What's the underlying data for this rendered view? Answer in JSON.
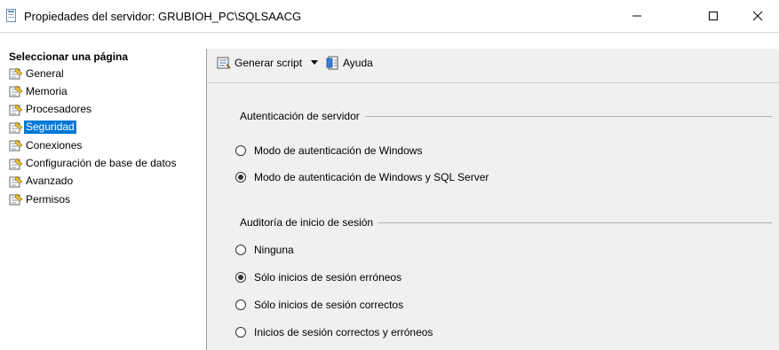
{
  "window": {
    "title": "Propiedades del servidor: GRUBIOH_PC\\SQLSAACG",
    "minimize_glyph": "—",
    "maximize_glyph": "☐",
    "close_glyph": "✕"
  },
  "left_pane": {
    "header": "Seleccionar una página",
    "pages": [
      {
        "label": "General",
        "icon": "page-icon"
      },
      {
        "label": "Memoria",
        "icon": "page-icon"
      },
      {
        "label": "Procesadores",
        "icon": "page-icon"
      },
      {
        "label": "Seguridad",
        "icon": "page-icon",
        "selected": true
      },
      {
        "label": "Conexiones",
        "icon": "page-icon"
      },
      {
        "label": "Configuración de base de datos",
        "icon": "page-icon"
      },
      {
        "label": "Avanzado",
        "icon": "page-icon"
      },
      {
        "label": "Permisos",
        "icon": "page-icon"
      }
    ]
  },
  "toolbar": {
    "script_label": "Generar script",
    "script_icon": "script-icon",
    "dropdown_icon": "dropdown-arrow-icon",
    "help_label": "Ayuda",
    "help_icon": "help-icon"
  },
  "server_auth": {
    "title": "Autenticación de servidor",
    "options": [
      {
        "label": "Modo de autenticación de Windows",
        "checked": false
      },
      {
        "label": "Modo de autenticación de Windows y SQL Server",
        "checked": true
      }
    ]
  },
  "login_audit": {
    "title": "Auditoría de inicio de sesión",
    "options": [
      {
        "label": "Ninguna",
        "checked": false
      },
      {
        "label": "Sólo inicios de sesión erróneos",
        "checked": true
      },
      {
        "label": "Sólo inicios de sesión correctos",
        "checked": false
      },
      {
        "label": "Inicios de sesión correctos y erróneos",
        "checked": false
      }
    ]
  },
  "colors": {
    "selection": "#0078d7",
    "panel": "#f0f0f0"
  }
}
